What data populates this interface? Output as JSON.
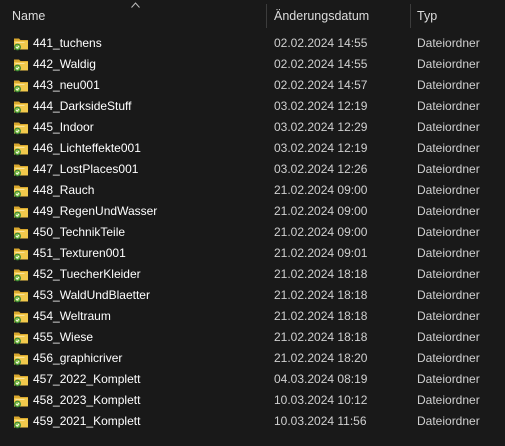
{
  "columns": {
    "name": "Name",
    "date": "Änderungsdatum",
    "type": "Typ"
  },
  "icons": {
    "folder": "folder-icon",
    "overlay": "sync-status-overlay-icon",
    "sort": "sort-ascending-icon"
  },
  "colors": {
    "background": "#191919",
    "folder_yellow": "#f2c94c",
    "overlay_green": "#8bc34a"
  },
  "rows": [
    {
      "name": "441_tuchens",
      "date": "02.02.2024 14:55",
      "type": "Dateiordner"
    },
    {
      "name": "442_Waldig",
      "date": "02.02.2024 14:55",
      "type": "Dateiordner"
    },
    {
      "name": "443_neu001",
      "date": "02.02.2024 14:57",
      "type": "Dateiordner"
    },
    {
      "name": "444_DarksideStuff",
      "date": "03.02.2024 12:19",
      "type": "Dateiordner"
    },
    {
      "name": "445_Indoor",
      "date": "03.02.2024 12:29",
      "type": "Dateiordner"
    },
    {
      "name": "446_Lichteffekte001",
      "date": "03.02.2024 12:19",
      "type": "Dateiordner"
    },
    {
      "name": "447_LostPlaces001",
      "date": "03.02.2024 12:26",
      "type": "Dateiordner"
    },
    {
      "name": "448_Rauch",
      "date": "21.02.2024 09:00",
      "type": "Dateiordner"
    },
    {
      "name": "449_RegenUndWasser",
      "date": "21.02.2024 09:00",
      "type": "Dateiordner"
    },
    {
      "name": "450_TechnikTeile",
      "date": "21.02.2024 09:00",
      "type": "Dateiordner"
    },
    {
      "name": "451_Texturen001",
      "date": "21.02.2024 09:01",
      "type": "Dateiordner"
    },
    {
      "name": "452_TuecherKleider",
      "date": "21.02.2024 18:18",
      "type": "Dateiordner"
    },
    {
      "name": "453_WaldUndBlaetter",
      "date": "21.02.2024 18:18",
      "type": "Dateiordner"
    },
    {
      "name": "454_Weltraum",
      "date": "21.02.2024 18:18",
      "type": "Dateiordner"
    },
    {
      "name": "455_Wiese",
      "date": "21.02.2024 18:18",
      "type": "Dateiordner"
    },
    {
      "name": "456_graphicriver",
      "date": "21.02.2024 18:20",
      "type": "Dateiordner"
    },
    {
      "name": "457_2022_Komplett",
      "date": "04.03.2024 08:19",
      "type": "Dateiordner"
    },
    {
      "name": "458_2023_Komplett",
      "date": "10.03.2024 10:12",
      "type": "Dateiordner"
    },
    {
      "name": "459_2021_Komplett",
      "date": "10.03.2024 11:56",
      "type": "Dateiordner"
    }
  ]
}
